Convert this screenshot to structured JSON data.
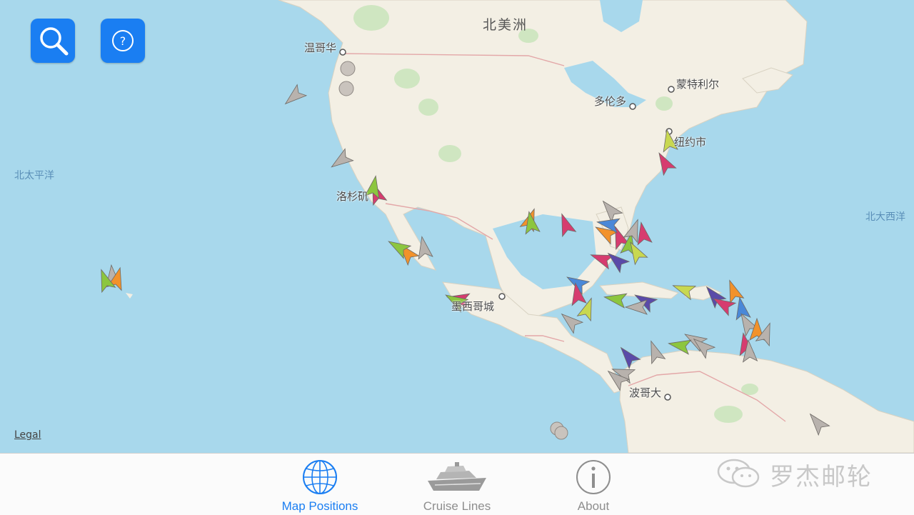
{
  "map": {
    "labels": {
      "continent": "北美洲",
      "vancouver": "温哥华",
      "toronto": "多伦多",
      "montreal": "蒙特利尔",
      "new_york": "纽约市",
      "los_angeles": "洛杉矶",
      "mexico_city": "墨西哥城",
      "bogota": "波哥大",
      "north_pacific": "北太平洋",
      "north_atlantic": "北大西洋"
    },
    "legal": "Legal",
    "colors": {
      "water": "#a8d8ec",
      "land": "#f3efe4",
      "park": "#cfe6c1",
      "border": "#e3a7a8",
      "ship_palette": [
        "#d63c6f",
        "#8cc63f",
        "#f2922b",
        "#b8b2ad",
        "#5a4aa8",
        "#4a88d8",
        "#c8d850"
      ]
    }
  },
  "controls": {
    "search_icon": "magnifier-icon",
    "help_icon": "question-circle-icon",
    "help_glyph": "?"
  },
  "tabs": [
    {
      "label": "Map Positions",
      "icon": "globe-icon",
      "active": true
    },
    {
      "label": "Cruise Lines",
      "icon": "cruise-ship-icon",
      "active": false
    },
    {
      "label": "About",
      "icon": "info-icon",
      "active": false
    }
  ],
  "watermark": {
    "text": "罗杰邮轮",
    "icon": "wechat-icon"
  }
}
